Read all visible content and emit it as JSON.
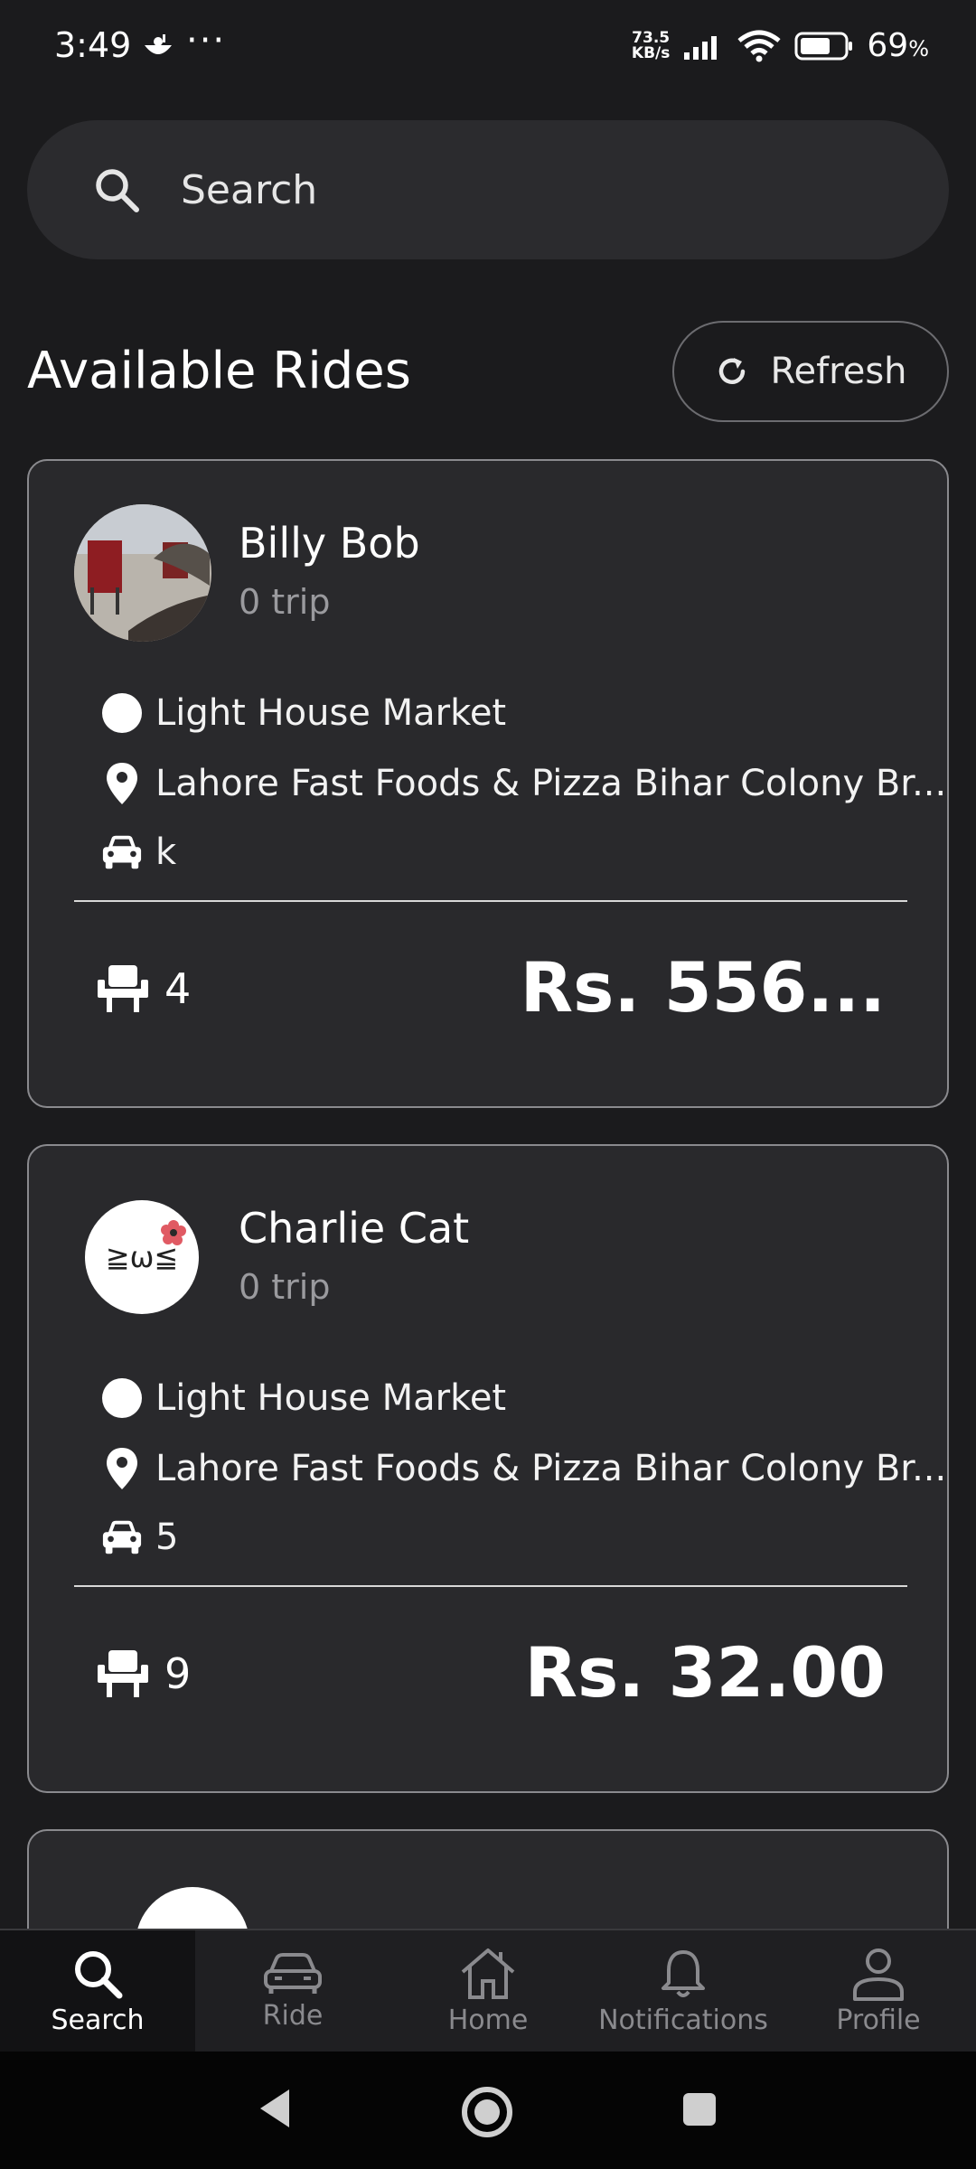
{
  "status_bar": {
    "time": "3:49",
    "net_speed_value": "73.5",
    "net_speed_unit": "KB/s",
    "battery_percent": "69",
    "battery_unit": "%"
  },
  "search": {
    "placeholder": "Search"
  },
  "header": {
    "title": "Available Rides",
    "refresh_label": "Refresh"
  },
  "rides": [
    {
      "driver_name": "Billy Bob",
      "trips": "0 trip",
      "pickup": "Light House Market",
      "dropoff": "Lahore Fast Foods & Pizza Bihar Colony Br...",
      "vehicle": "k",
      "seats": "4",
      "price": "Rs. 556..."
    },
    {
      "driver_name": "Charlie Cat",
      "avatar_text": "≧ω≦",
      "trips": "0 trip",
      "pickup": "Light House Market",
      "dropoff": "Lahore Fast Foods & Pizza Bihar Colony Br...",
      "vehicle": "5",
      "seats": "9",
      "price": "Rs. 32.00"
    }
  ],
  "bottom_nav": [
    {
      "label": "Search",
      "icon": "search-icon",
      "active": true
    },
    {
      "label": "Ride",
      "icon": "car-icon",
      "active": false
    },
    {
      "label": "Home",
      "icon": "home-icon",
      "active": false
    },
    {
      "label": "Notifications",
      "icon": "bell-icon",
      "active": false
    },
    {
      "label": "Profile",
      "icon": "person-icon",
      "active": false
    }
  ],
  "colors": {
    "background": "#1b1b1d",
    "card": "#29292c",
    "accent_active": "#ffffff",
    "muted": "#8a8a8e"
  }
}
